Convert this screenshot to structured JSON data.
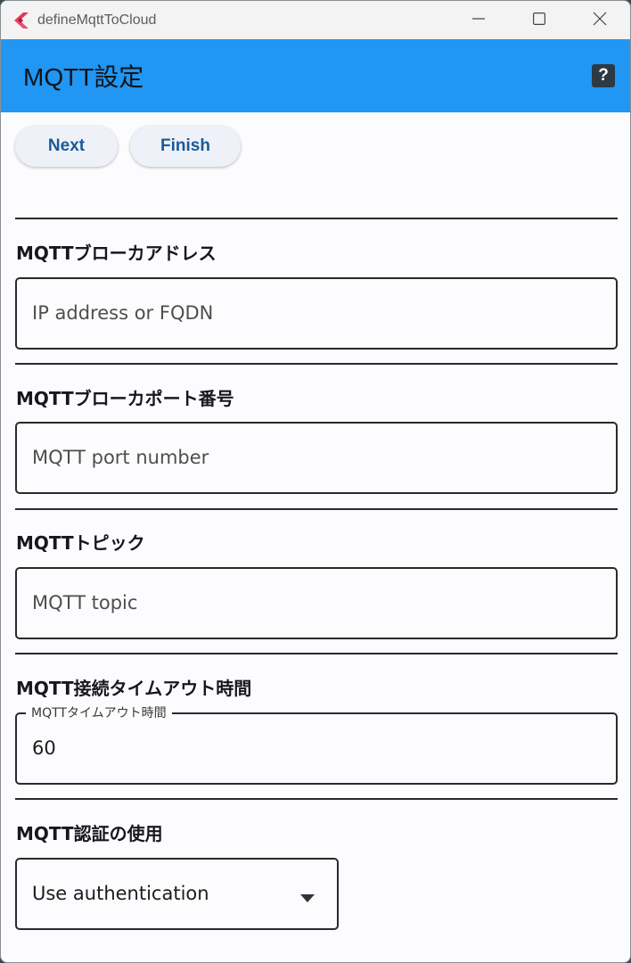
{
  "window": {
    "title": "defineMqttToCloud",
    "minimize_glyph": "—",
    "icons": {
      "app": "flutter-logo-icon",
      "minimize": "minimize-icon",
      "maximize": "maximize-icon",
      "close": "close-icon"
    }
  },
  "appbar": {
    "title": "MQTT設定",
    "help_glyph": "?",
    "color": "#2196f3"
  },
  "actions": {
    "next_label": "Next",
    "finish_label": "Finish"
  },
  "sections": {
    "broker_address": {
      "label": "MQTTブローカアドレス",
      "placeholder": "IP address or FQDN",
      "value": ""
    },
    "broker_port": {
      "label": "MQTTブローカポート番号",
      "placeholder": "MQTT port number",
      "value": ""
    },
    "topic": {
      "label": "MQTTトピック",
      "placeholder": "MQTT topic",
      "value": ""
    },
    "timeout": {
      "label": "MQTT接続タイムアウト時間",
      "floating_label": "MQTTタイムアウト時間",
      "value": "60"
    },
    "auth": {
      "label": "MQTT認証の使用",
      "selected": "Use authentication"
    }
  }
}
